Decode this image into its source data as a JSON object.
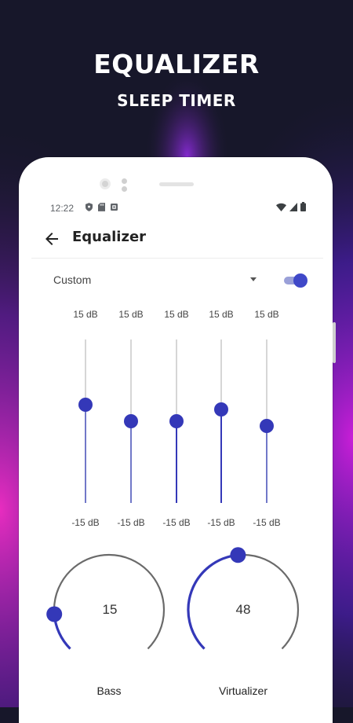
{
  "promo": {
    "title": "EQUALIZER",
    "subtitle": "SLEEP TIMER"
  },
  "status_bar": {
    "time": "12:22",
    "left_icons": [
      "shield-icon",
      "sd-card-icon",
      "notification-box-icon"
    ],
    "right_icons": [
      "wifi-icon",
      "signal-icon",
      "battery-icon"
    ]
  },
  "app_bar": {
    "back_icon": "arrow-left-icon",
    "title": "Equalizer"
  },
  "preset": {
    "selected": "Custom",
    "enabled": true
  },
  "colors": {
    "accent": "#3438b8",
    "accent_light": "#9aa0d8",
    "track": "#d6d6d6",
    "background": "#17172a"
  },
  "bands": [
    {
      "top_label": "15 dB",
      "bottom_label": "-15 dB",
      "level": 0.6
    },
    {
      "top_label": "15 dB",
      "bottom_label": "-15 dB",
      "level": 0.5
    },
    {
      "top_label": "15 dB",
      "bottom_label": "-15 dB",
      "level": 0.5
    },
    {
      "top_label": "15 dB",
      "bottom_label": "-15 dB",
      "level": 0.57
    },
    {
      "top_label": "15 dB",
      "bottom_label": "-15 dB",
      "level": 0.47
    }
  ],
  "knobs": [
    {
      "label": "Bass",
      "value": "15",
      "level": 0.15
    },
    {
      "label": "Virtualizer",
      "value": "48",
      "level": 0.48
    }
  ]
}
